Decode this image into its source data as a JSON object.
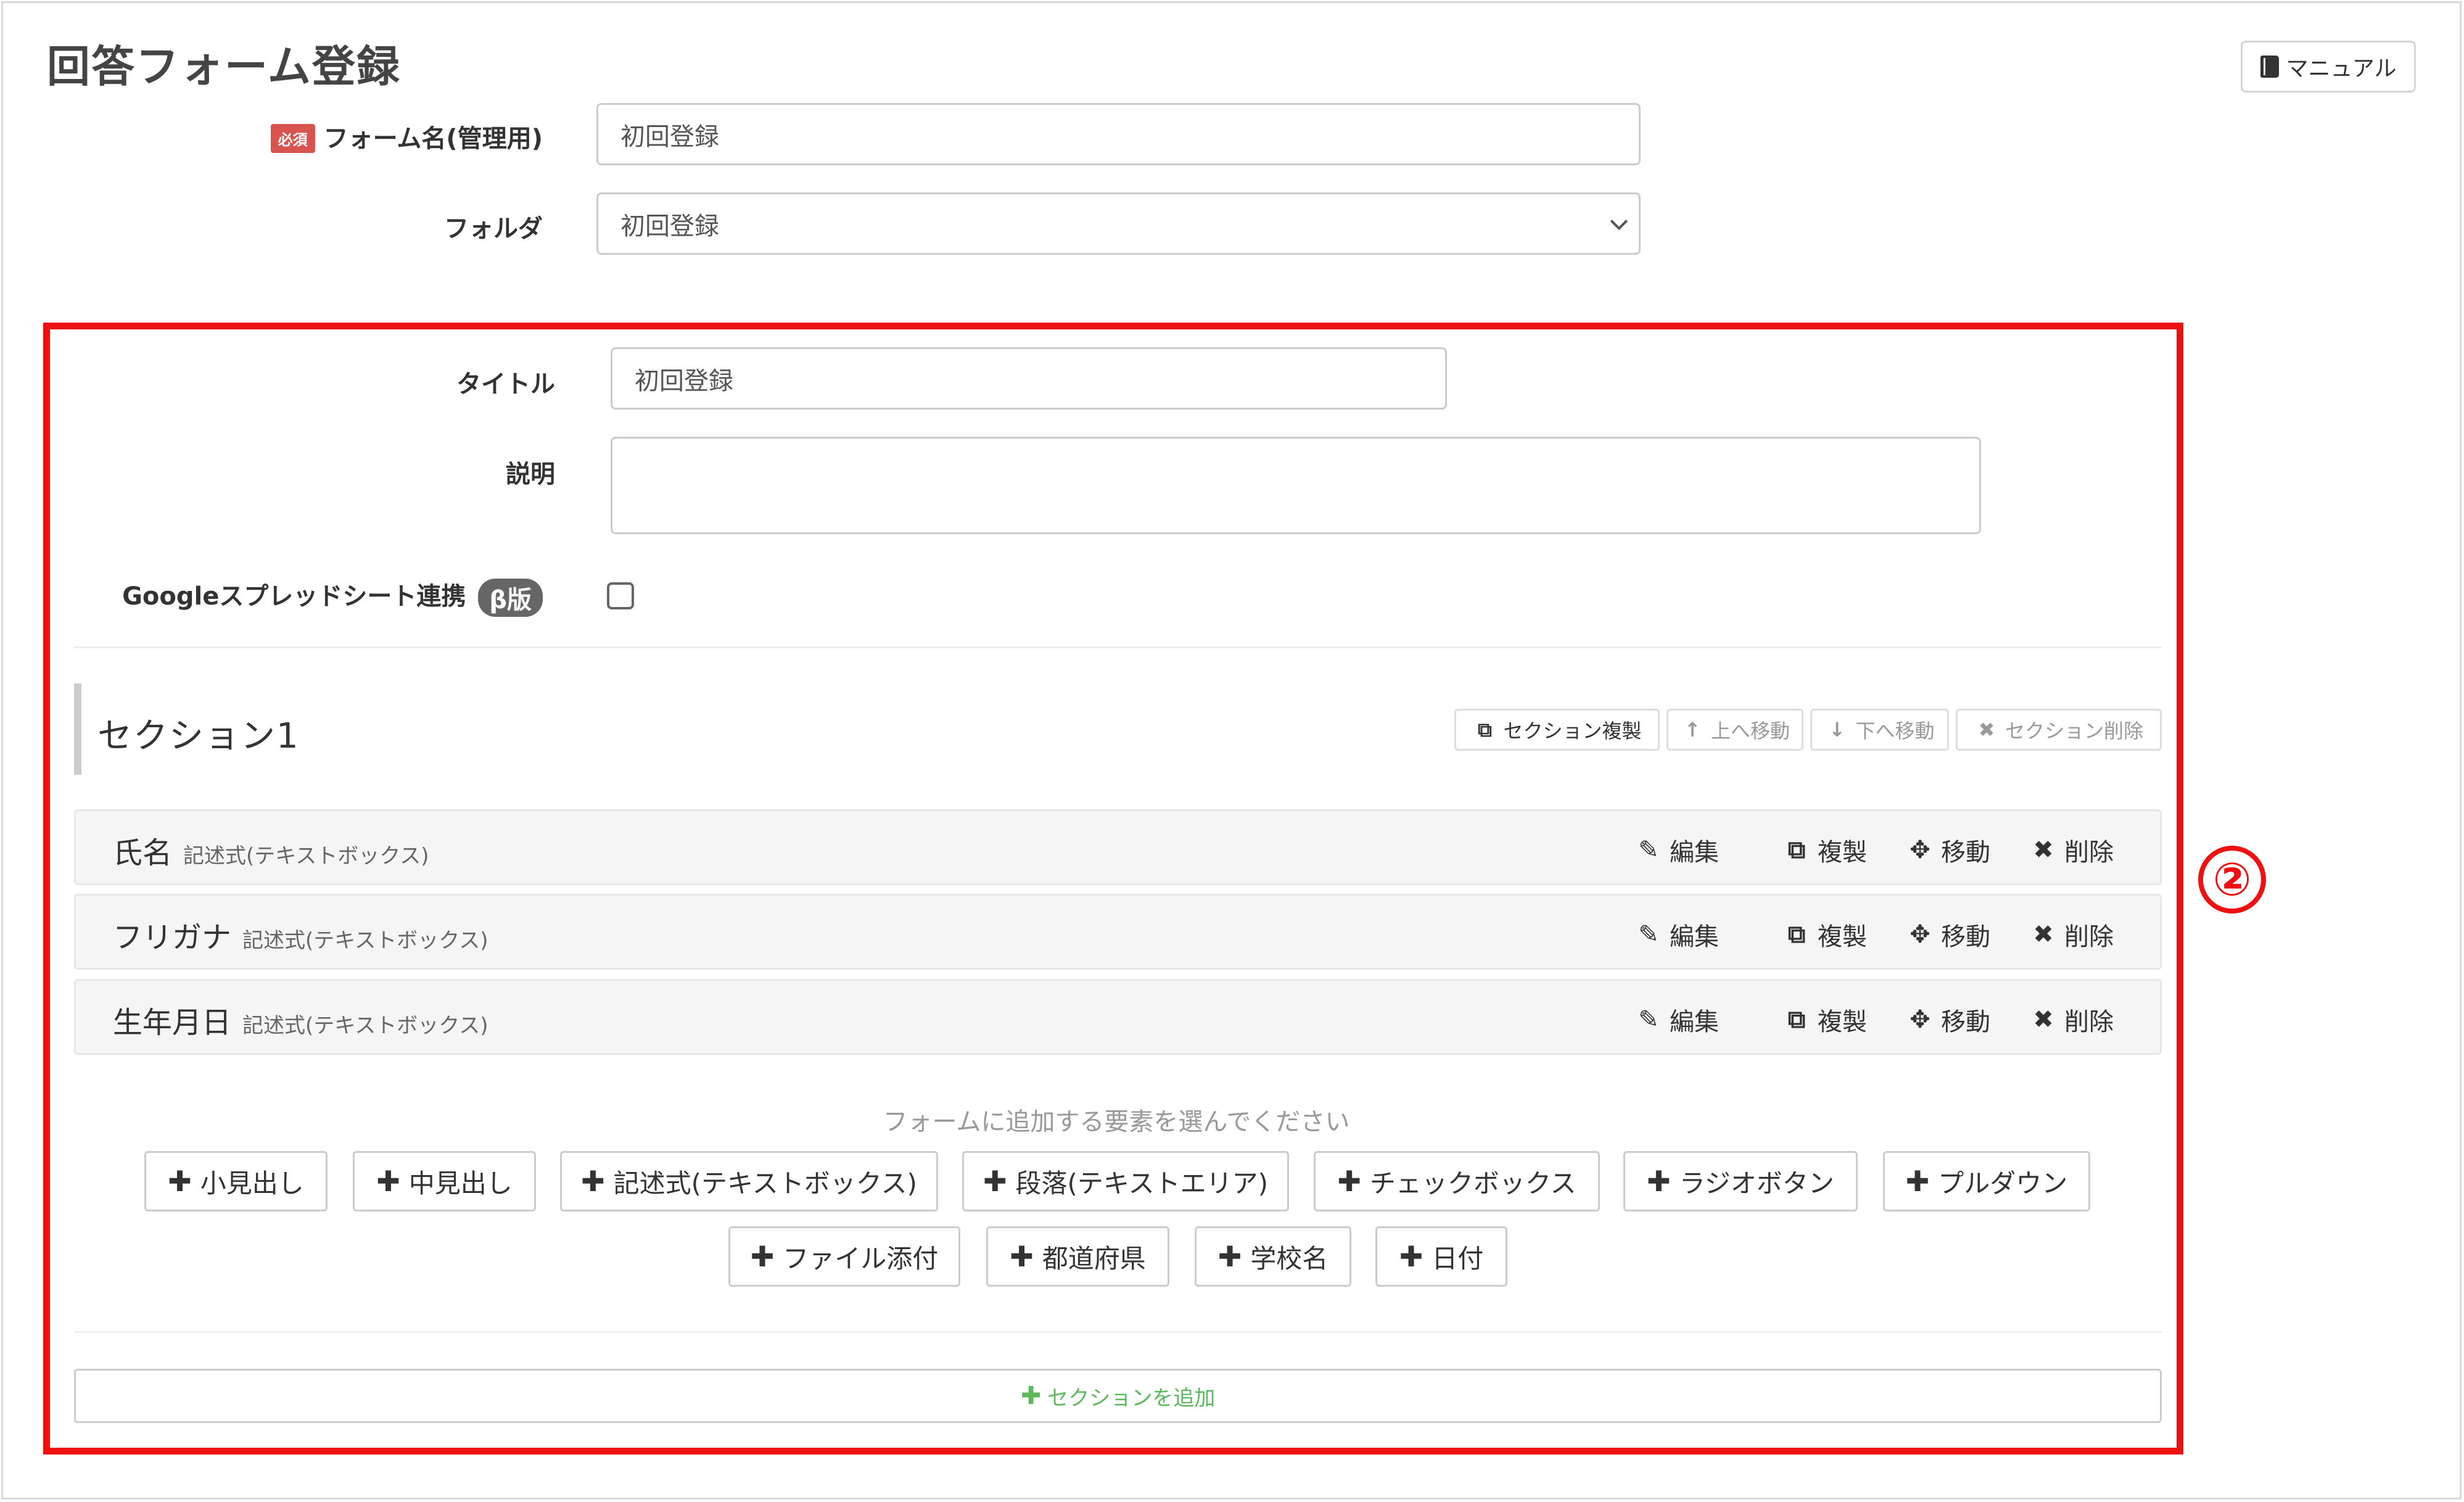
{
  "page": {
    "title": "回答フォーム登録",
    "manual_label": "マニュアル"
  },
  "form_meta": {
    "required_badge": "必須",
    "name_label": "フォーム名(管理用)",
    "name_value": "初回登録",
    "folder_label": "フォルダ",
    "folder_value": "初回登録"
  },
  "details": {
    "title_label": "タイトル",
    "title_value": "初回登録",
    "description_label": "説明",
    "description_value": "",
    "sheets_label": "Googleスプレッドシート連携",
    "beta_badge": "β版",
    "sheets_checked": false
  },
  "annotation": {
    "number": "②"
  },
  "section": {
    "title": "セクション1",
    "actions": {
      "duplicate": "セクション複製",
      "move_up": "上へ移動",
      "move_down": "下へ移動",
      "delete": "セクション削除"
    }
  },
  "fields": [
    {
      "name": "氏名",
      "type": "記述式(テキストボックス)"
    },
    {
      "name": "フリガナ",
      "type": "記述式(テキストボックス)"
    },
    {
      "name": "生年月日",
      "type": "記述式(テキストボックス)"
    }
  ],
  "field_actions": {
    "edit": "編集",
    "duplicate": "複製",
    "move": "移動",
    "delete": "削除"
  },
  "add_hint": "フォームに追加する要素を選んでください",
  "add_elements": [
    "小見出し",
    "中見出し",
    "記述式(テキストボックス)",
    "段落(テキストエリア)",
    "チェックボックス",
    "ラジオボタン",
    "プルダウン",
    "ファイル添付",
    "都道府県",
    "学校名",
    "日付"
  ],
  "add_section_label": "セクションを追加",
  "colors": {
    "annotation": "#ee1111",
    "required": "#d9534f",
    "add_section": "#5cb85c"
  }
}
